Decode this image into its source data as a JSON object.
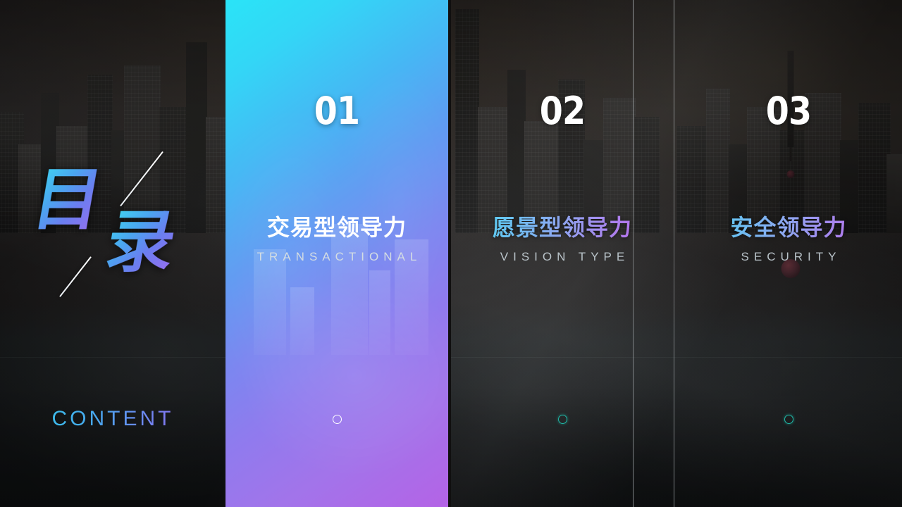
{
  "slide": {
    "kind": "presentation-agenda-slide",
    "heading_cn": "目录",
    "heading_char_1": "目",
    "heading_char_2": "录",
    "heading_en": "CONTENT"
  },
  "theme": {
    "accent_cyan": "#2ae4f7",
    "accent_blue": "#5f9bf2",
    "accent_purple": "#b463e6",
    "background_dark": "#1c1a19",
    "divider": "#d6dee2",
    "dot_white": "#ffffff",
    "dot_teal": "#1fb9a8"
  },
  "columns": [
    {
      "number": "01",
      "title_cn": "交易型领导力",
      "title_en": "TRANSACTIONAL",
      "dot": "bullet-marker",
      "style": "gradient-panel"
    },
    {
      "number": "02",
      "title_cn": "愿景型领导力",
      "title_en": "VISION TYPE",
      "dot": "bullet-marker",
      "style": "photo-dark"
    },
    {
      "number": "03",
      "title_cn": "安全领导力",
      "title_en": "SECURITY",
      "dot": "bullet-marker",
      "style": "photo-dark"
    }
  ]
}
